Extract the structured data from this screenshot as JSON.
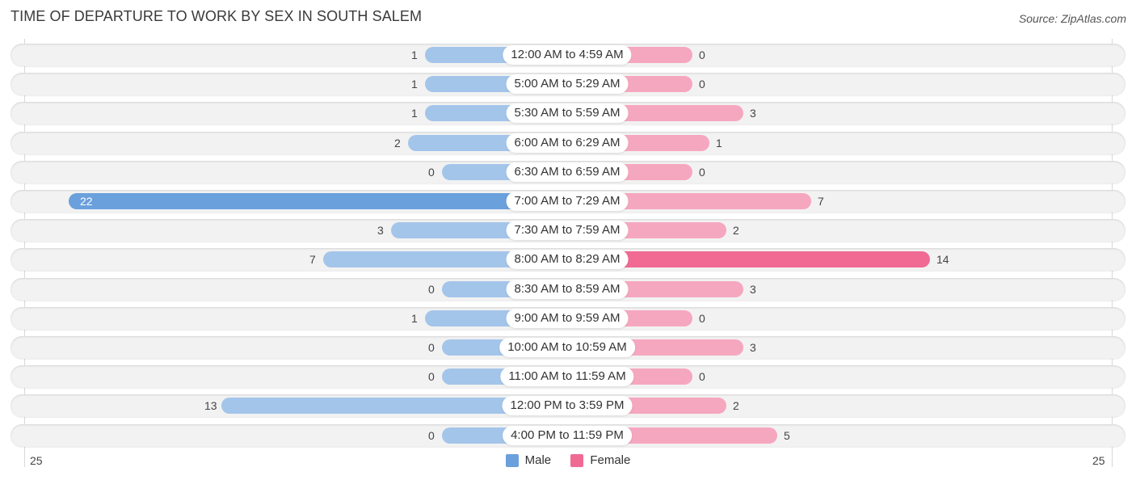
{
  "title": "TIME OF DEPARTURE TO WORK BY SEX IN SOUTH SALEM",
  "source": "Source: ZipAtlas.com",
  "colors": {
    "male": "#6aa0dc",
    "female": "#f06a94",
    "male_light": "#a4c5ea",
    "female_light": "#f6a7c0"
  },
  "legend": {
    "male": "Male",
    "female": "Female"
  },
  "axis": {
    "left_label": "25",
    "right_label": "25"
  },
  "chart_data": {
    "type": "bar",
    "orientation": "horizontal-diverging",
    "title": "TIME OF DEPARTURE TO WORK BY SEX IN SOUTH SALEM",
    "categories": [
      "12:00 AM to 4:59 AM",
      "5:00 AM to 5:29 AM",
      "5:30 AM to 5:59 AM",
      "6:00 AM to 6:29 AM",
      "6:30 AM to 6:59 AM",
      "7:00 AM to 7:29 AM",
      "7:30 AM to 7:59 AM",
      "8:00 AM to 8:29 AM",
      "8:30 AM to 8:59 AM",
      "9:00 AM to 9:59 AM",
      "10:00 AM to 10:59 AM",
      "11:00 AM to 11:59 AM",
      "12:00 PM to 3:59 PM",
      "4:00 PM to 11:59 PM"
    ],
    "series": [
      {
        "name": "Male",
        "values": [
          1,
          1,
          1,
          2,
          0,
          22,
          3,
          7,
          0,
          1,
          0,
          0,
          13,
          0
        ]
      },
      {
        "name": "Female",
        "values": [
          0,
          0,
          3,
          1,
          0,
          7,
          2,
          14,
          3,
          0,
          3,
          0,
          2,
          5
        ]
      }
    ],
    "xlim": [
      -25,
      25
    ],
    "tick_labels": [
      "25",
      "25"
    ],
    "legend_position": "bottom-center",
    "grid": false
  }
}
